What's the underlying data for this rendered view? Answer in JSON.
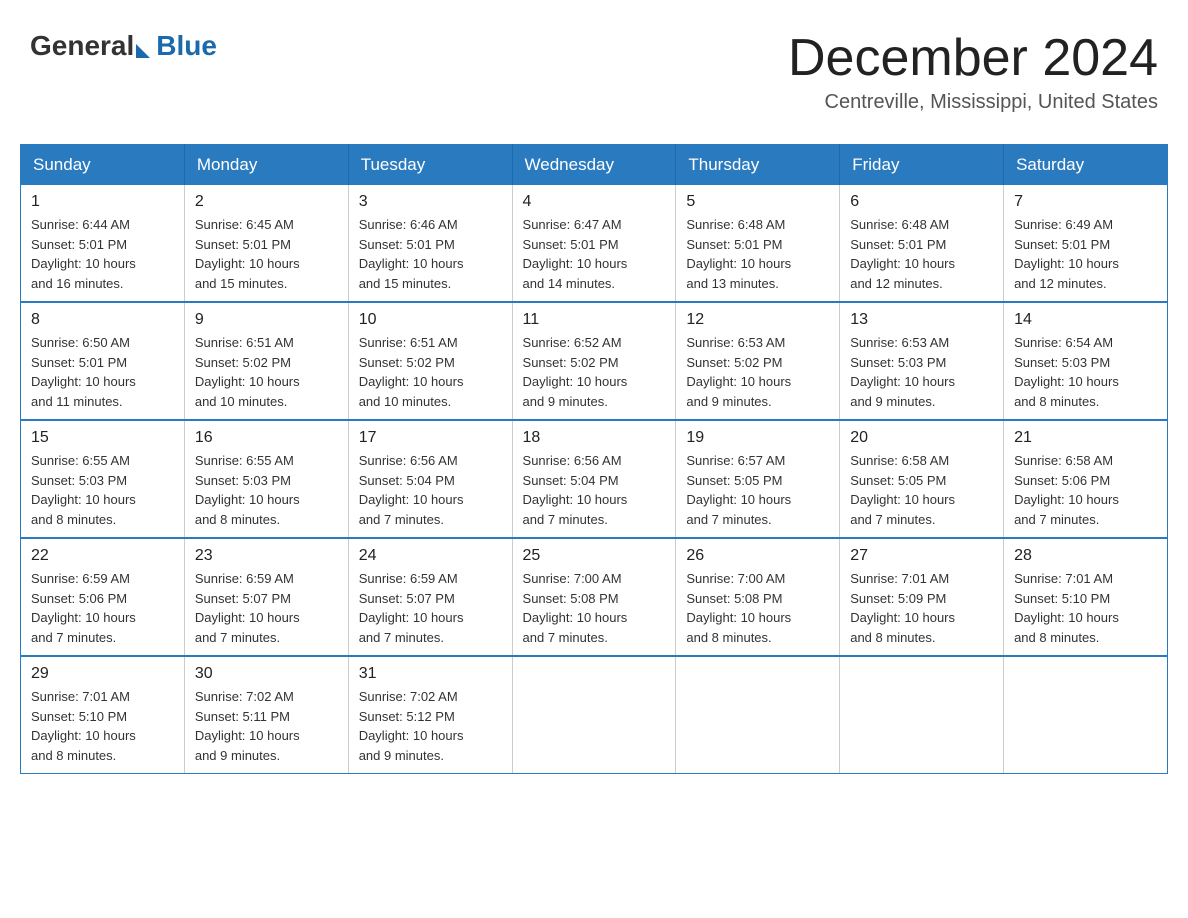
{
  "logo": {
    "general": "General",
    "blue": "Blue"
  },
  "header": {
    "month": "December 2024",
    "location": "Centreville, Mississippi, United States"
  },
  "weekdays": [
    "Sunday",
    "Monday",
    "Tuesday",
    "Wednesday",
    "Thursday",
    "Friday",
    "Saturday"
  ],
  "weeks": [
    [
      {
        "day": "1",
        "sunrise": "6:44 AM",
        "sunset": "5:01 PM",
        "daylight": "10 hours and 16 minutes."
      },
      {
        "day": "2",
        "sunrise": "6:45 AM",
        "sunset": "5:01 PM",
        "daylight": "10 hours and 15 minutes."
      },
      {
        "day": "3",
        "sunrise": "6:46 AM",
        "sunset": "5:01 PM",
        "daylight": "10 hours and 15 minutes."
      },
      {
        "day": "4",
        "sunrise": "6:47 AM",
        "sunset": "5:01 PM",
        "daylight": "10 hours and 14 minutes."
      },
      {
        "day": "5",
        "sunrise": "6:48 AM",
        "sunset": "5:01 PM",
        "daylight": "10 hours and 13 minutes."
      },
      {
        "day": "6",
        "sunrise": "6:48 AM",
        "sunset": "5:01 PM",
        "daylight": "10 hours and 12 minutes."
      },
      {
        "day": "7",
        "sunrise": "6:49 AM",
        "sunset": "5:01 PM",
        "daylight": "10 hours and 12 minutes."
      }
    ],
    [
      {
        "day": "8",
        "sunrise": "6:50 AM",
        "sunset": "5:01 PM",
        "daylight": "10 hours and 11 minutes."
      },
      {
        "day": "9",
        "sunrise": "6:51 AM",
        "sunset": "5:02 PM",
        "daylight": "10 hours and 10 minutes."
      },
      {
        "day": "10",
        "sunrise": "6:51 AM",
        "sunset": "5:02 PM",
        "daylight": "10 hours and 10 minutes."
      },
      {
        "day": "11",
        "sunrise": "6:52 AM",
        "sunset": "5:02 PM",
        "daylight": "10 hours and 9 minutes."
      },
      {
        "day": "12",
        "sunrise": "6:53 AM",
        "sunset": "5:02 PM",
        "daylight": "10 hours and 9 minutes."
      },
      {
        "day": "13",
        "sunrise": "6:53 AM",
        "sunset": "5:03 PM",
        "daylight": "10 hours and 9 minutes."
      },
      {
        "day": "14",
        "sunrise": "6:54 AM",
        "sunset": "5:03 PM",
        "daylight": "10 hours and 8 minutes."
      }
    ],
    [
      {
        "day": "15",
        "sunrise": "6:55 AM",
        "sunset": "5:03 PM",
        "daylight": "10 hours and 8 minutes."
      },
      {
        "day": "16",
        "sunrise": "6:55 AM",
        "sunset": "5:03 PM",
        "daylight": "10 hours and 8 minutes."
      },
      {
        "day": "17",
        "sunrise": "6:56 AM",
        "sunset": "5:04 PM",
        "daylight": "10 hours and 7 minutes."
      },
      {
        "day": "18",
        "sunrise": "6:56 AM",
        "sunset": "5:04 PM",
        "daylight": "10 hours and 7 minutes."
      },
      {
        "day": "19",
        "sunrise": "6:57 AM",
        "sunset": "5:05 PM",
        "daylight": "10 hours and 7 minutes."
      },
      {
        "day": "20",
        "sunrise": "6:58 AM",
        "sunset": "5:05 PM",
        "daylight": "10 hours and 7 minutes."
      },
      {
        "day": "21",
        "sunrise": "6:58 AM",
        "sunset": "5:06 PM",
        "daylight": "10 hours and 7 minutes."
      }
    ],
    [
      {
        "day": "22",
        "sunrise": "6:59 AM",
        "sunset": "5:06 PM",
        "daylight": "10 hours and 7 minutes."
      },
      {
        "day": "23",
        "sunrise": "6:59 AM",
        "sunset": "5:07 PM",
        "daylight": "10 hours and 7 minutes."
      },
      {
        "day": "24",
        "sunrise": "6:59 AM",
        "sunset": "5:07 PM",
        "daylight": "10 hours and 7 minutes."
      },
      {
        "day": "25",
        "sunrise": "7:00 AM",
        "sunset": "5:08 PM",
        "daylight": "10 hours and 7 minutes."
      },
      {
        "day": "26",
        "sunrise": "7:00 AM",
        "sunset": "5:08 PM",
        "daylight": "10 hours and 8 minutes."
      },
      {
        "day": "27",
        "sunrise": "7:01 AM",
        "sunset": "5:09 PM",
        "daylight": "10 hours and 8 minutes."
      },
      {
        "day": "28",
        "sunrise": "7:01 AM",
        "sunset": "5:10 PM",
        "daylight": "10 hours and 8 minutes."
      }
    ],
    [
      {
        "day": "29",
        "sunrise": "7:01 AM",
        "sunset": "5:10 PM",
        "daylight": "10 hours and 8 minutes."
      },
      {
        "day": "30",
        "sunrise": "7:02 AM",
        "sunset": "5:11 PM",
        "daylight": "10 hours and 9 minutes."
      },
      {
        "day": "31",
        "sunrise": "7:02 AM",
        "sunset": "5:12 PM",
        "daylight": "10 hours and 9 minutes."
      },
      null,
      null,
      null,
      null
    ]
  ],
  "labels": {
    "sunrise": "Sunrise:",
    "sunset": "Sunset:",
    "daylight": "Daylight:"
  }
}
